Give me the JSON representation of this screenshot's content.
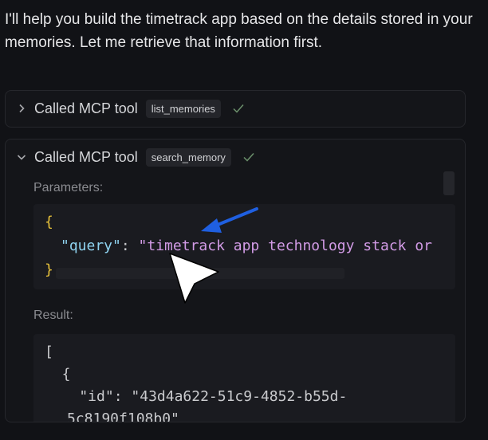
{
  "message": {
    "intro_text": "I'll help you build the timetrack app based on the details stored in your memories. Let me retrieve that information first."
  },
  "tool_calls": [
    {
      "state": "collapsed",
      "label": "Called MCP tool",
      "tool_name": "list_memories",
      "status": "success"
    },
    {
      "state": "expanded",
      "label": "Called MCP tool",
      "tool_name": "search_memory",
      "status": "success",
      "parameters_label": "Parameters:",
      "parameters_code": {
        "open_brace": "{",
        "key": "\"query\"",
        "colon": ": ",
        "value": "\"timetrack app technology stack or",
        "close_brace": "}"
      },
      "result_label": "Result:",
      "result_code": {
        "line1": "[",
        "line2": "  {",
        "line3_key": "    \"id\"",
        "line3_colon": ": ",
        "line3_value": "\"43d4a622-51c9-4852-b55d-",
        "line4_partial": "5c8190f108b0\""
      }
    }
  ],
  "colors": {
    "background": "#111216",
    "card": "#141519",
    "code_bg": "#1a1b20",
    "json_key": "#8fd3f0",
    "json_string": "#d29be6",
    "brace": "#e8c23a",
    "check": "#6b8f6b",
    "arrow_annotation": "#1f5fe0"
  },
  "icons": {
    "collapsed_chevron": "chevron-right-icon",
    "expanded_chevron": "chevron-down-icon",
    "status": "checkmark-icon",
    "annotation": "blue-arrow-icon",
    "pointer": "mouse-cursor-icon"
  }
}
